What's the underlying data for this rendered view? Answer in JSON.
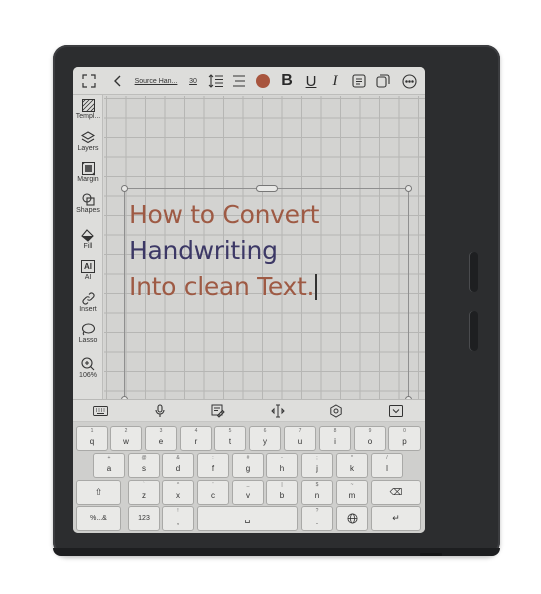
{
  "toolbar": {
    "font_name": "Source Han...",
    "font_size": "30",
    "bold": "B",
    "underline": "U",
    "italic": "I",
    "text_color": "#a8553e"
  },
  "sidebar": {
    "items": [
      {
        "label": "Templ...",
        "icon": "template-icon"
      },
      {
        "label": "Layers",
        "icon": "layers-icon"
      },
      {
        "label": "Margin",
        "icon": "margin-icon"
      },
      {
        "label": "Shapes",
        "icon": "shapes-icon"
      },
      {
        "label": "Fill",
        "icon": "fill-icon"
      },
      {
        "label": "AI",
        "icon": "ai-icon",
        "glyph": "AI"
      },
      {
        "label": "Insert",
        "icon": "insert-link-icon"
      },
      {
        "label": "Lasso",
        "icon": "lasso-icon"
      },
      {
        "label": "106%",
        "icon": "zoom-in-icon"
      }
    ]
  },
  "canvas": {
    "lines": [
      "How to Convert",
      "Handwriting",
      "Into clean Text."
    ],
    "line_colors": [
      "#9e5a44",
      "#3c3866",
      "#9e5a44"
    ]
  },
  "keyboard": {
    "row1": [
      {
        "main": "q",
        "sub": "1"
      },
      {
        "main": "w",
        "sub": "2"
      },
      {
        "main": "e",
        "sub": "3"
      },
      {
        "main": "r",
        "sub": "4"
      },
      {
        "main": "t",
        "sub": "5"
      },
      {
        "main": "y",
        "sub": "6"
      },
      {
        "main": "u",
        "sub": "7"
      },
      {
        "main": "i",
        "sub": "8"
      },
      {
        "main": "o",
        "sub": "9"
      },
      {
        "main": "p",
        "sub": "0"
      }
    ],
    "row2": [
      {
        "main": "a",
        "sub": "+"
      },
      {
        "main": "s",
        "sub": "@"
      },
      {
        "main": "d",
        "sub": "&"
      },
      {
        "main": "f",
        "sub": ":"
      },
      {
        "main": "g",
        "sub": "#"
      },
      {
        "main": "h",
        "sub": "-"
      },
      {
        "main": "j",
        "sub": ";"
      },
      {
        "main": "k",
        "sub": "*"
      },
      {
        "main": "l",
        "sub": "/"
      }
    ],
    "row3": [
      {
        "main": "z",
        "sub": "`"
      },
      {
        "main": "x",
        "sub": "^"
      },
      {
        "main": "c",
        "sub": "'"
      },
      {
        "main": "v",
        "sub": "_"
      },
      {
        "main": "b",
        "sub": "|"
      },
      {
        "main": "n",
        "sub": "$"
      },
      {
        "main": "m",
        "sub": "~"
      }
    ],
    "shift": "⇧",
    "backspace": "⌫",
    "symbols": "%...&",
    "numbers": "123",
    "comma": ",",
    "comma_sub": "!",
    "space": "␣",
    "period": ".",
    "period_sub": "?",
    "globe": "🌐",
    "enter": "↵"
  }
}
